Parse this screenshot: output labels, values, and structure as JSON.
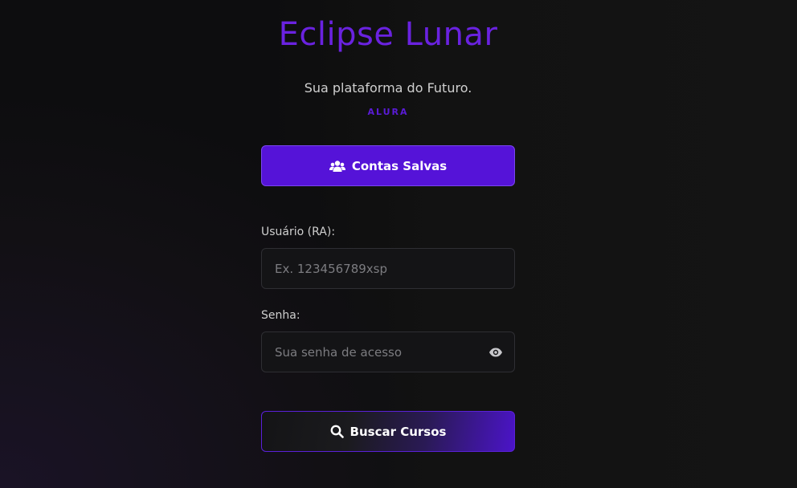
{
  "header": {
    "title": "Eclipse Lunar",
    "subtitle": "Sua plataforma do Futuro.",
    "brand": "ALURA"
  },
  "saved_accounts": {
    "label": "Contas Salvas",
    "icon": "users-icon"
  },
  "form": {
    "user": {
      "label": "Usuário (RA):",
      "placeholder": "Ex. 123456789xsp",
      "value": ""
    },
    "password": {
      "label": "Senha:",
      "placeholder": "Sua senha de acesso",
      "value": "",
      "toggle_icon": "eye-icon"
    }
  },
  "search": {
    "label": "Buscar Cursos",
    "icon": "search-icon"
  },
  "colors": {
    "accent": "#5513d8",
    "title": "#6a22e0",
    "background": "#121212"
  }
}
